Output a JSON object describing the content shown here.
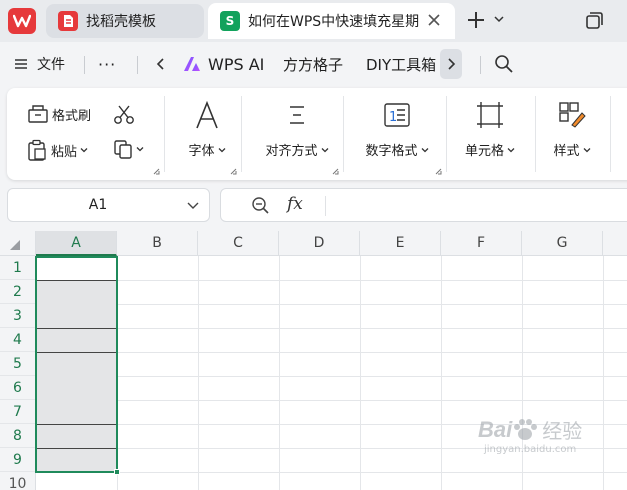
{
  "app": {
    "tabs": [
      {
        "label": "找稻壳模板",
        "icon": "docer-icon"
      },
      {
        "label": "如何在WPS中快速填充星期",
        "icon": "spreadsheet-s-icon",
        "icon_text": "S"
      }
    ]
  },
  "menubar": {
    "file_label": "文件",
    "more_label": "···",
    "wps_ai_label": "WPS AI",
    "fangfang_label": "方方格子",
    "diy_label": "DIY工具箱"
  },
  "ribbon": {
    "format_painter": "格式刷",
    "paste": "粘贴",
    "font": "字体",
    "align": "对齐方式",
    "number_format": "数字格式",
    "cell": "单元格",
    "style": "样式"
  },
  "formula_bar": {
    "name_box_value": "A1",
    "fx_label": "fx"
  },
  "grid": {
    "columns": [
      "A",
      "B",
      "C",
      "D",
      "E",
      "F",
      "G"
    ],
    "rows": [
      "1",
      "2",
      "3",
      "4",
      "5",
      "6",
      "7",
      "8",
      "9",
      "10"
    ],
    "selected_column": "A"
  },
  "watermark": {
    "brand": "Bai",
    "brand_cn": "经验",
    "url": "jingyan.baidu.com"
  },
  "colors": {
    "accent_green": "#1f8a5b",
    "wps_red": "#e6393b",
    "sheet_green": "#12a25c"
  }
}
